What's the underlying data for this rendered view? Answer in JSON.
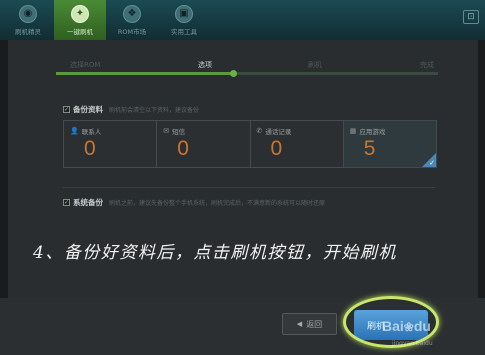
{
  "toolbar": {
    "tools": [
      {
        "label": "刷机精灵",
        "icon": "phone-icon"
      },
      {
        "label": "一键刷机",
        "icon": "flash-icon",
        "active": true
      },
      {
        "label": "ROM市场",
        "icon": "rom-icon"
      },
      {
        "label": "实用工具",
        "icon": "tools-icon"
      }
    ]
  },
  "steps": {
    "items": [
      "选择ROM",
      "选项",
      "刷机",
      "完成"
    ],
    "current_index": 1
  },
  "backup_data": {
    "title": "备份资料",
    "description": "刷机前会清空以下资料，建议备份",
    "cards": [
      {
        "label": "联系人",
        "value": "0",
        "icon": "contact-icon"
      },
      {
        "label": "短信",
        "value": "0",
        "icon": "sms-icon"
      },
      {
        "label": "通话记录",
        "value": "0",
        "icon": "call-log-icon"
      },
      {
        "label": "应用游戏",
        "value": "5",
        "icon": "apps-icon",
        "selected": true
      }
    ]
  },
  "system_backup": {
    "title": "系统备份",
    "description": "刷机之前，建议先备份整个手机系统，刷机完成后，不满意新的系统可以随时还原"
  },
  "caption": "4、备份好资料后，点击刷机按钮，开始刷机",
  "buttons": {
    "back_label": "返回",
    "flash_label": "刷机"
  },
  "watermark": {
    "brand": "Bai",
    "brand_suffix": "du",
    "sub": "jingyan.baidu"
  },
  "colors": {
    "accent_green": "#5d9a3b",
    "count_orange": "#c9752f",
    "flash_blue": "#2a72b4",
    "highlight": "#c8e66a"
  }
}
